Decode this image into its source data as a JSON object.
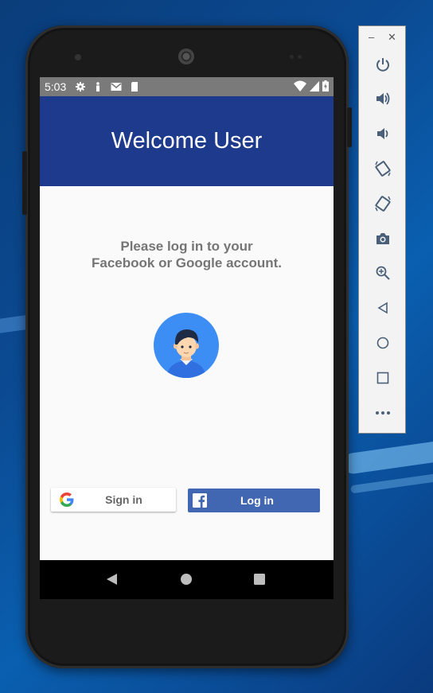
{
  "status_bar": {
    "time": "5:03"
  },
  "app_bar": {
    "title": "Welcome User"
  },
  "main": {
    "message_line1": "Please log in to your",
    "message_line2": "Facebook or Google account."
  },
  "buttons": {
    "google_label": "Sign in",
    "facebook_label": "Log in"
  },
  "colors": {
    "app_bar": "#1e3a8c",
    "facebook": "#4267b2",
    "avatar_bg": "#3d8ef4"
  },
  "toolbar": {
    "items": [
      "power-icon",
      "volume-up-icon",
      "volume-down-icon",
      "rotate-left-icon",
      "rotate-right-icon",
      "camera-icon",
      "zoom-icon",
      "back-icon",
      "home-icon",
      "overview-icon",
      "more-icon"
    ]
  }
}
